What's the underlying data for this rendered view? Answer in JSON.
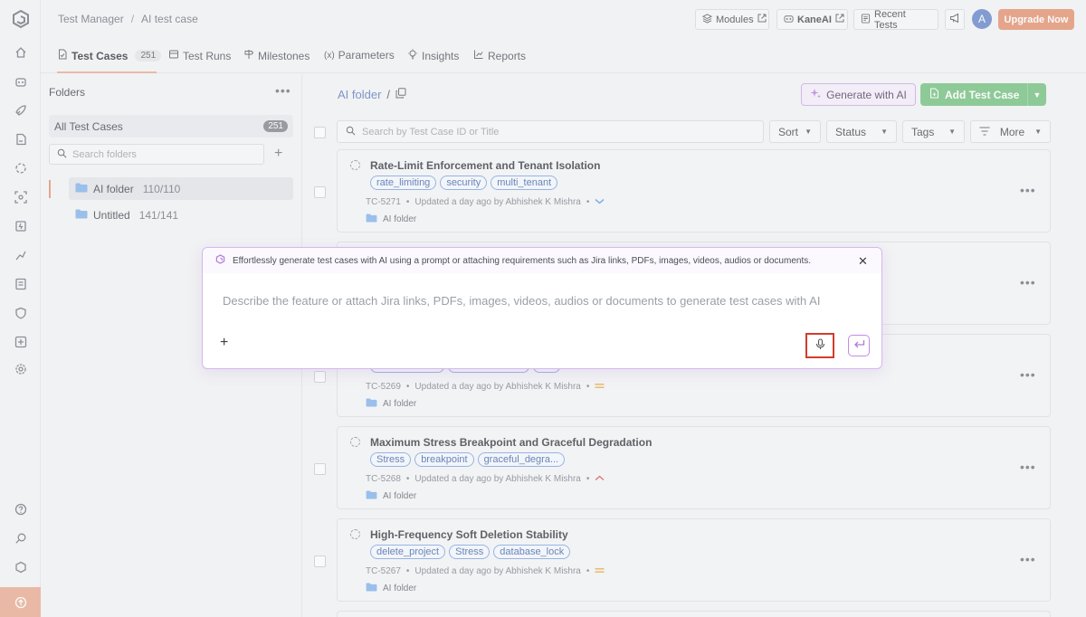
{
  "breadcrumb": {
    "root": "Test Manager",
    "separator": "/",
    "current": "AI test case"
  },
  "topbar": {
    "modules_label": "Modules",
    "kaneai_label": "KaneAI",
    "recent_tests_label": "Recent Tests",
    "avatar_initial": "A",
    "upgrade_label": "Upgrade Now"
  },
  "tabs": [
    {
      "label": "Test Cases",
      "count": "251"
    },
    {
      "label": "Test Runs"
    },
    {
      "label": "Milestones"
    },
    {
      "label": "Parameters"
    },
    {
      "label": "Insights"
    },
    {
      "label": "Reports"
    }
  ],
  "folders": {
    "header": "Folders",
    "all_label": "All Test Cases",
    "all_count": "251",
    "search_placeholder": "Search folders",
    "items": [
      {
        "name": "AI folder",
        "count": "110/110"
      },
      {
        "name": "Untitled",
        "count": "141/141"
      }
    ]
  },
  "main": {
    "folder_title": "AI folder",
    "folder_sep": "/",
    "generate_ai_label": "Generate with AI",
    "add_test_case_label": "Add Test Case",
    "search_placeholder": "Search by Test Case ID or Title",
    "filters": {
      "sort": "Sort",
      "status": "Status",
      "tags": "Tags",
      "more": "More"
    }
  },
  "test_cases": [
    {
      "title": "Rate-Limit Enforcement and Tenant Isolation",
      "tags": [
        "rate_limiting",
        "security",
        "multi_tenant"
      ],
      "id": "TC-5271",
      "updated": "Updated a day ago by Abhishek K Mishra",
      "priority": "low",
      "folder": "AI folder"
    },
    {
      "title": "",
      "tags": [],
      "id": "",
      "updated": "",
      "priority": "",
      "folder": ""
    },
    {
      "title": "",
      "tags": [],
      "id": "TC-5269",
      "updated": "Updated a day ago by Abhishek K Mishra",
      "priority": "medium",
      "folder": "AI folder"
    },
    {
      "title": "Maximum Stress Breakpoint and Graceful Degradation",
      "tags": [
        "Stress",
        "breakpoint",
        "graceful_degra..."
      ],
      "id": "TC-5268",
      "updated": "Updated a day ago by Abhishek K Mishra",
      "priority": "high",
      "folder": "AI folder"
    },
    {
      "title": "High-Frequency Soft Deletion Stability",
      "tags": [
        "delete_project",
        "Stress",
        "database_lock"
      ],
      "id": "TC-5267",
      "updated": "Updated a day ago by Abhishek K Mishra",
      "priority": "medium",
      "folder": "AI folder"
    }
  ],
  "ai_dialog": {
    "header_text": "Effortlessly generate test cases with AI using a prompt or attaching requirements such as Jira links, PDFs, images, videos, audios or documents.",
    "prompt_placeholder": "Describe the feature or attach Jira links, PDFs, images, videos, audios or documents to generate test cases with AI",
    "attach_label": "+"
  },
  "colors": {
    "accent_orange": "#e38e6a",
    "add_green": "#6fbf7a",
    "ai_purple": "#c48ae6",
    "tag_blue": "#3f63a8",
    "mic_highlight": "#d23c2c",
    "priority_low": "#4a8fe0",
    "priority_medium": "#e8a234",
    "priority_high": "#d9534f"
  },
  "icons": {
    "rail": [
      "home-icon",
      "robot-icon",
      "rocket-icon",
      "test-manager-icon",
      "hyperexecute-icon",
      "visual-icon",
      "automation-icon",
      "analytics-icon",
      "reports-icon",
      "security-icon",
      "add-icon",
      "settings-icon",
      "help-icon",
      "search-icon",
      "integrations-icon",
      "upload-icon"
    ]
  }
}
